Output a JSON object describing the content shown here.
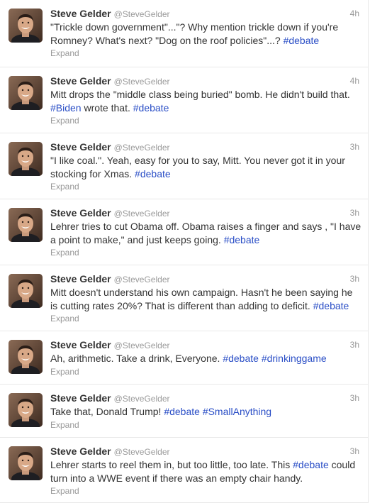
{
  "tweets": [
    {
      "name": "Steve Gelder",
      "handle": "@SteveGelder",
      "time": "4h",
      "parts": [
        {
          "t": "\"Trickle down government\"...\"? Why mention trickle down if you're Romney? What's next? \"Dog on the roof policies\"...? ",
          "tag": false
        },
        {
          "t": "#debate",
          "tag": true
        }
      ],
      "expand": "Expand"
    },
    {
      "name": "Steve Gelder",
      "handle": "@SteveGelder",
      "time": "4h",
      "parts": [
        {
          "t": "Mitt drops the \"middle class being buried\" bomb. He didn't build that. ",
          "tag": false
        },
        {
          "t": "#Biden",
          "tag": true
        },
        {
          "t": " wrote that. ",
          "tag": false
        },
        {
          "t": "#debate",
          "tag": true
        }
      ],
      "expand": "Expand"
    },
    {
      "name": "Steve Gelder",
      "handle": "@SteveGelder",
      "time": "3h",
      "parts": [
        {
          "t": "\"I like coal.\". Yeah, easy for you to say, Mitt. You never got it in your stocking for Xmas. ",
          "tag": false
        },
        {
          "t": "#debate",
          "tag": true
        }
      ],
      "expand": "Expand"
    },
    {
      "name": "Steve Gelder",
      "handle": "@SteveGelder",
      "time": "3h",
      "parts": [
        {
          "t": "Lehrer tries to cut Obama off. Obama raises a finger and says , \"I have a point to make,\" and just keeps going. ",
          "tag": false
        },
        {
          "t": "#debate",
          "tag": true
        }
      ],
      "expand": "Expand"
    },
    {
      "name": "Steve Gelder",
      "handle": "@SteveGelder",
      "time": "3h",
      "parts": [
        {
          "t": "Mitt doesn't understand his own campaign. Hasn't he been saying he is cutting rates 20%? That is different than adding to deficit. ",
          "tag": false
        },
        {
          "t": "#debate",
          "tag": true
        }
      ],
      "expand": "Expand"
    },
    {
      "name": "Steve Gelder",
      "handle": "@SteveGelder",
      "time": "3h",
      "parts": [
        {
          "t": "Ah, arithmetic. Take a drink, Everyone. ",
          "tag": false
        },
        {
          "t": "#debate",
          "tag": true
        },
        {
          "t": " ",
          "tag": false
        },
        {
          "t": "#drinkinggame",
          "tag": true
        }
      ],
      "expand": "Expand"
    },
    {
      "name": "Steve Gelder",
      "handle": "@SteveGelder",
      "time": "3h",
      "parts": [
        {
          "t": "Take that, Donald Trump! ",
          "tag": false
        },
        {
          "t": "#debate",
          "tag": true
        },
        {
          "t": " ",
          "tag": false
        },
        {
          "t": "#SmallAnything",
          "tag": true
        }
      ],
      "expand": "Expand"
    },
    {
      "name": "Steve Gelder",
      "handle": "@SteveGelder",
      "time": "3h",
      "parts": [
        {
          "t": "Lehrer starts to reel them in, but too little, too late. This ",
          "tag": false
        },
        {
          "t": "#debate",
          "tag": true
        },
        {
          "t": " could turn into a WWE event if there was an empty chair handy.",
          "tag": false
        }
      ],
      "expand": "Expand"
    }
  ],
  "colors": {
    "hashtag": "#2a4ec6",
    "meta": "#999999",
    "text": "#333333"
  },
  "icons": {
    "avatar": "avatar-photo"
  }
}
